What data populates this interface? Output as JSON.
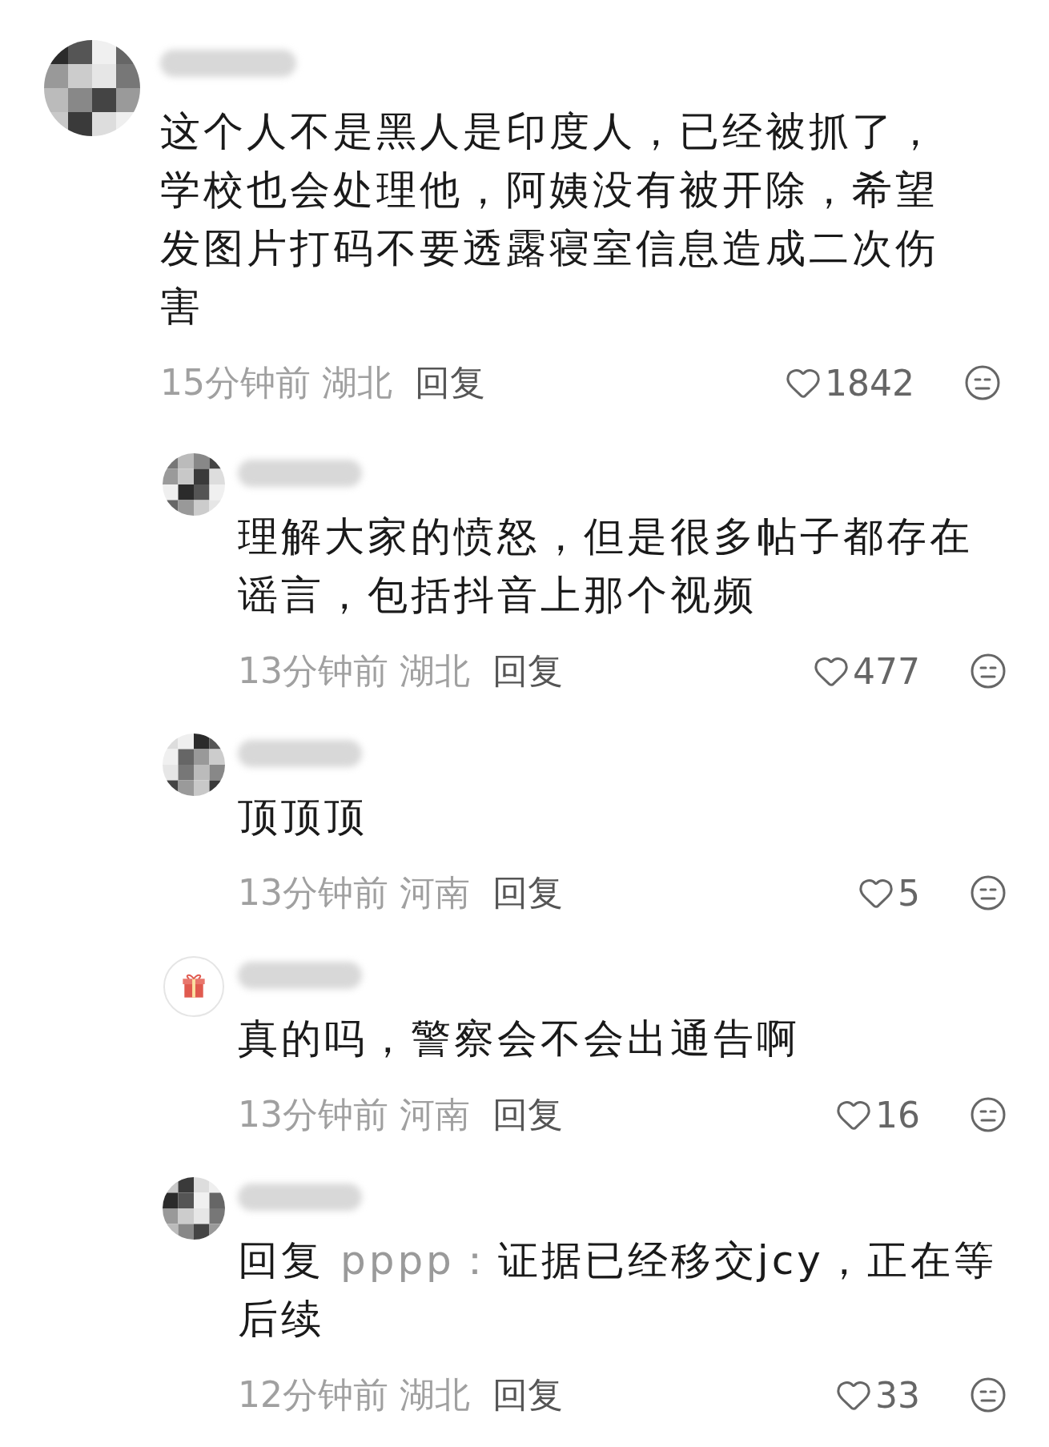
{
  "comments": [
    {
      "avatar": {
        "kind": "mosaic"
      },
      "text": "这个人不是黑人是印度人，已经被抓了，学校也会处理他，阿姨没有被开除，希望发图片打码不要透露寝室信息造成二次伤害",
      "time": "15分钟前",
      "location": "湖北",
      "reply_label": "回复",
      "likes": "1842",
      "replies": [
        {
          "avatar": {
            "kind": "mosaic"
          },
          "text": "理解大家的愤怒，但是很多帖子都存在谣言，包括抖音上那个视频",
          "time": "13分钟前",
          "location": "湖北",
          "reply_label": "回复",
          "likes": "477"
        },
        {
          "avatar": {
            "kind": "mosaic"
          },
          "text": "顶顶顶",
          "time": "13分钟前",
          "location": "河南",
          "reply_label": "回复",
          "likes": "5"
        },
        {
          "avatar": {
            "kind": "gift"
          },
          "text": "真的吗，警察会不会出通告啊",
          "time": "13分钟前",
          "location": "河南",
          "reply_label": "回复",
          "likes": "16"
        },
        {
          "avatar": {
            "kind": "mosaic"
          },
          "reply_prefix": "回复",
          "reply_to": "pppp：",
          "text": "证据已经移交jcy，正在等后续",
          "time": "12分钟前",
          "location": "湖北",
          "reply_label": "回复",
          "likes": "33"
        }
      ]
    }
  ]
}
